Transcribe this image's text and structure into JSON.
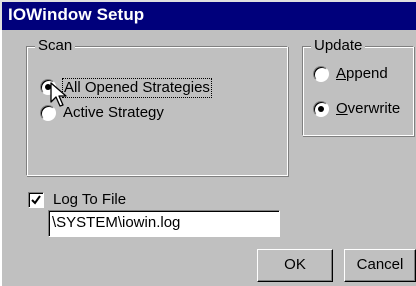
{
  "window": {
    "title": "IOWindow Setup"
  },
  "scan": {
    "label": "Scan",
    "options": [
      {
        "label": "All Opened Strategies",
        "selected": true
      },
      {
        "label": "Active Strategy",
        "selected": false
      }
    ]
  },
  "update": {
    "label": "Update",
    "options": [
      {
        "label_underline": "A",
        "label_rest": "ppend",
        "selected": false
      },
      {
        "label_underline": "O",
        "label_rest": "verwrite",
        "selected": true
      }
    ]
  },
  "log": {
    "checkbox_label": "Log To File",
    "checked": true,
    "file_path": "\\SYSTEM\\iowin.log"
  },
  "buttons": {
    "ok": "OK",
    "cancel": "Cancel"
  },
  "cursor": {
    "icon": "arrow-cursor-icon"
  }
}
